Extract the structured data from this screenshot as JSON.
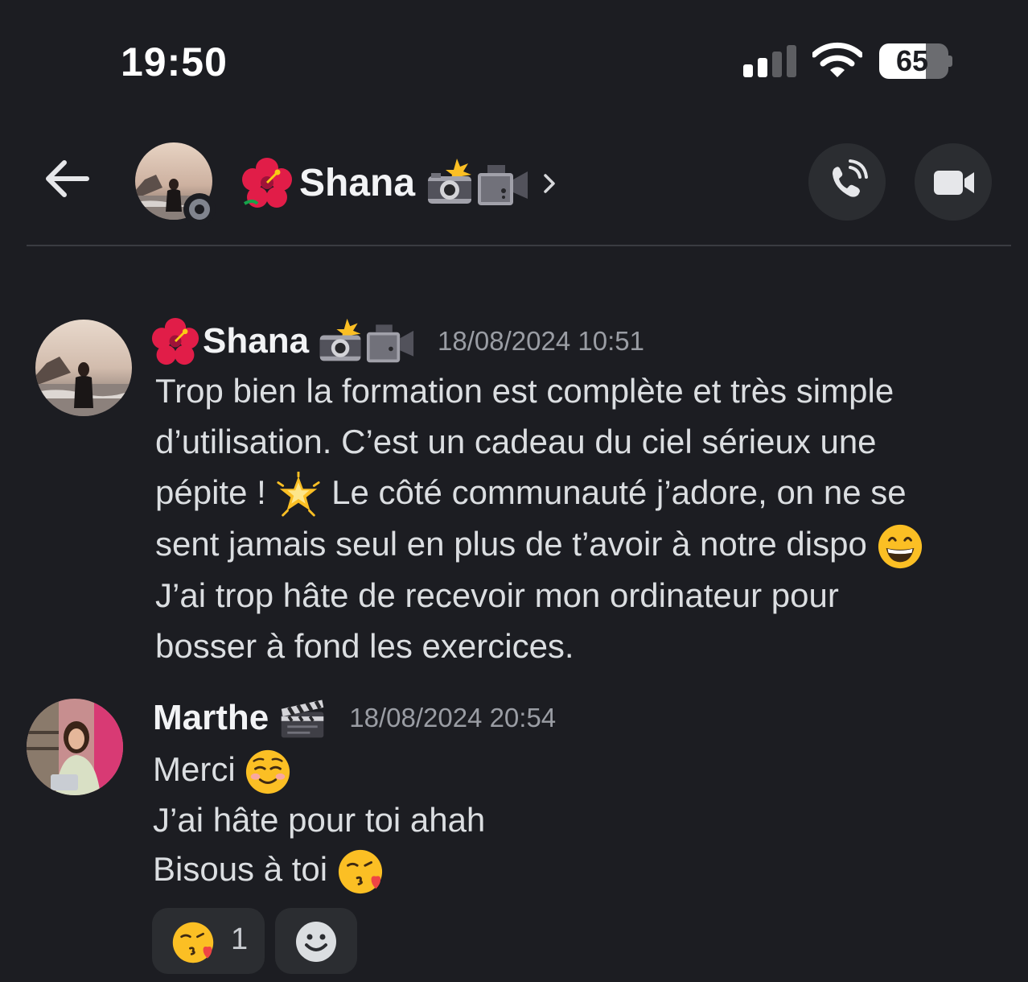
{
  "status_bar": {
    "time": "19:50",
    "battery_level": "65",
    "battery_fraction": 0.65,
    "signal_bars_active": 2,
    "signal_bars_total": 4,
    "icons": [
      "signal-icon",
      "wifi-icon",
      "battery-icon"
    ]
  },
  "header": {
    "back_icon": "arrow-left-icon",
    "contact_name": "Shana",
    "presence": "idle",
    "call_icon": "phone-icon",
    "video_icon": "video-camera-icon",
    "chevron_icon": "chevron-right-icon"
  },
  "messages": [
    {
      "author": "Shana",
      "timestamp": "18/08/2024 10:51",
      "lines": [
        "Trop bien la formation est complète et très simple",
        "d’utilisation. C’est un cadeau du ciel sérieux une",
        "pépite ! ",
        " Le côté communauté j’adore, on ne se",
        "sent jamais seul en plus de t’avoir à notre dispo ",
        "J’ai trop hâte de recevoir mon ordinateur pour",
        "bosser à fond les exercices."
      ]
    },
    {
      "author": "Marthe",
      "timestamp": "18/08/2024 20:54",
      "lines": [
        "Merci ",
        "J’ai hâte pour toi ahah",
        "Bisous à toi "
      ]
    }
  ],
  "reactions": [
    {
      "emoji": "face-blowing-kiss-emoji",
      "count": "1"
    },
    {
      "emoji": "add-reaction-icon"
    }
  ],
  "colors": {
    "background": "#1c1d22",
    "button_bg": "#2b2d31",
    "text_primary": "#f2f3f5",
    "text_body": "#dbdee1",
    "text_muted": "#9a9da4"
  }
}
